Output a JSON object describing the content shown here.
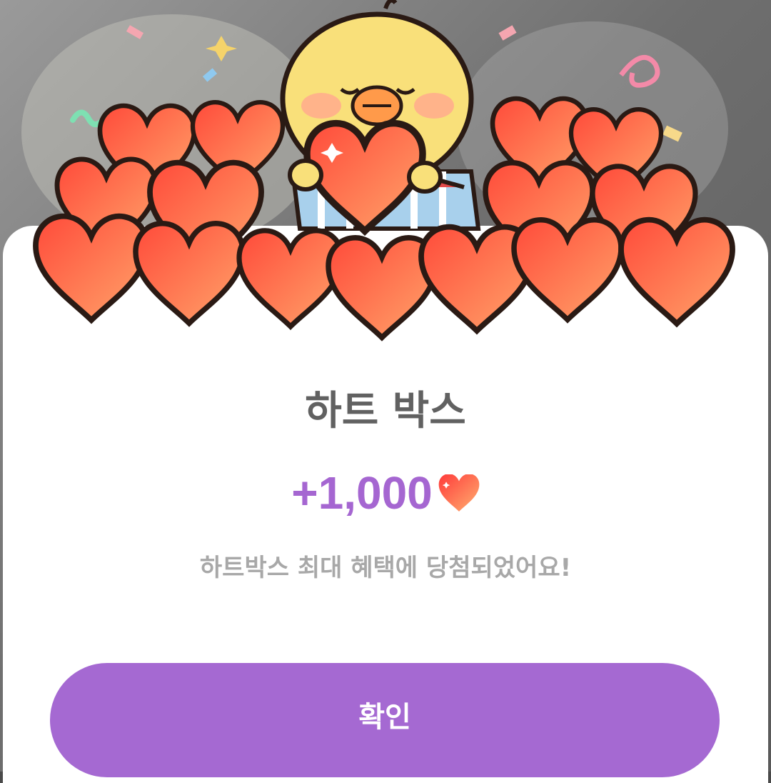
{
  "dialog": {
    "title": "하트 박스",
    "reward_amount": "+1,000",
    "reward_icon": "heart-icon",
    "message": "하트박스 최대 혜택에 당첨되었어요!",
    "confirm_label": "확인"
  },
  "illustration": {
    "subject": "chick-holding-heart-on-heart-pile-icon"
  },
  "colors": {
    "accent": "#a566d1",
    "button": "#a569d2",
    "title": "#616161",
    "message": "#a8a8a8",
    "heart": "#ff5a3c"
  }
}
